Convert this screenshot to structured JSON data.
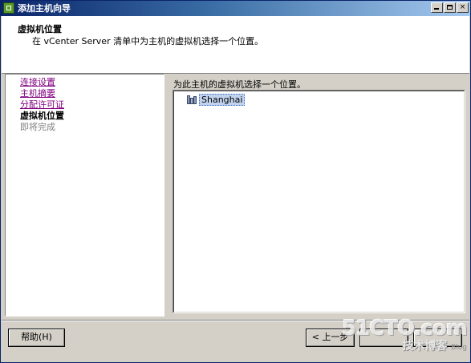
{
  "window": {
    "title": "添加主机向导",
    "buttons": {
      "minimize": "_",
      "maximize": "□",
      "close": "×"
    }
  },
  "header": {
    "title": "虚拟机位置",
    "subtitle": "在 vCenter Server 清单中为主机的虚拟机选择一个位置。"
  },
  "nav": {
    "items": [
      {
        "label": "连接设置",
        "state": "visited"
      },
      {
        "label": "主机摘要",
        "state": "visited"
      },
      {
        "label": "分配许可证",
        "state": "visited"
      },
      {
        "label": "虚拟机位置",
        "state": "current"
      },
      {
        "label": "即将完成",
        "state": "pending"
      }
    ]
  },
  "content": {
    "prompt": "为此主机的虚拟机选择一个位置。",
    "tree": [
      {
        "label": "Shanghai",
        "icon": "datacenter-icon",
        "selected": true
      }
    ]
  },
  "footer": {
    "help_label": "帮助(H)",
    "back_label": "< 上一步",
    "next_label": "",
    "cancel_label": ""
  },
  "watermark": {
    "logo": "51CTO.com",
    "sub": "技术博客",
    "blog": "Blog"
  },
  "colors": {
    "titlebar_start": "#0a246a",
    "titlebar_end": "#a6caf0",
    "visited_link": "#800080",
    "selection": "#c1d2ee",
    "face": "#d4d0c8"
  }
}
